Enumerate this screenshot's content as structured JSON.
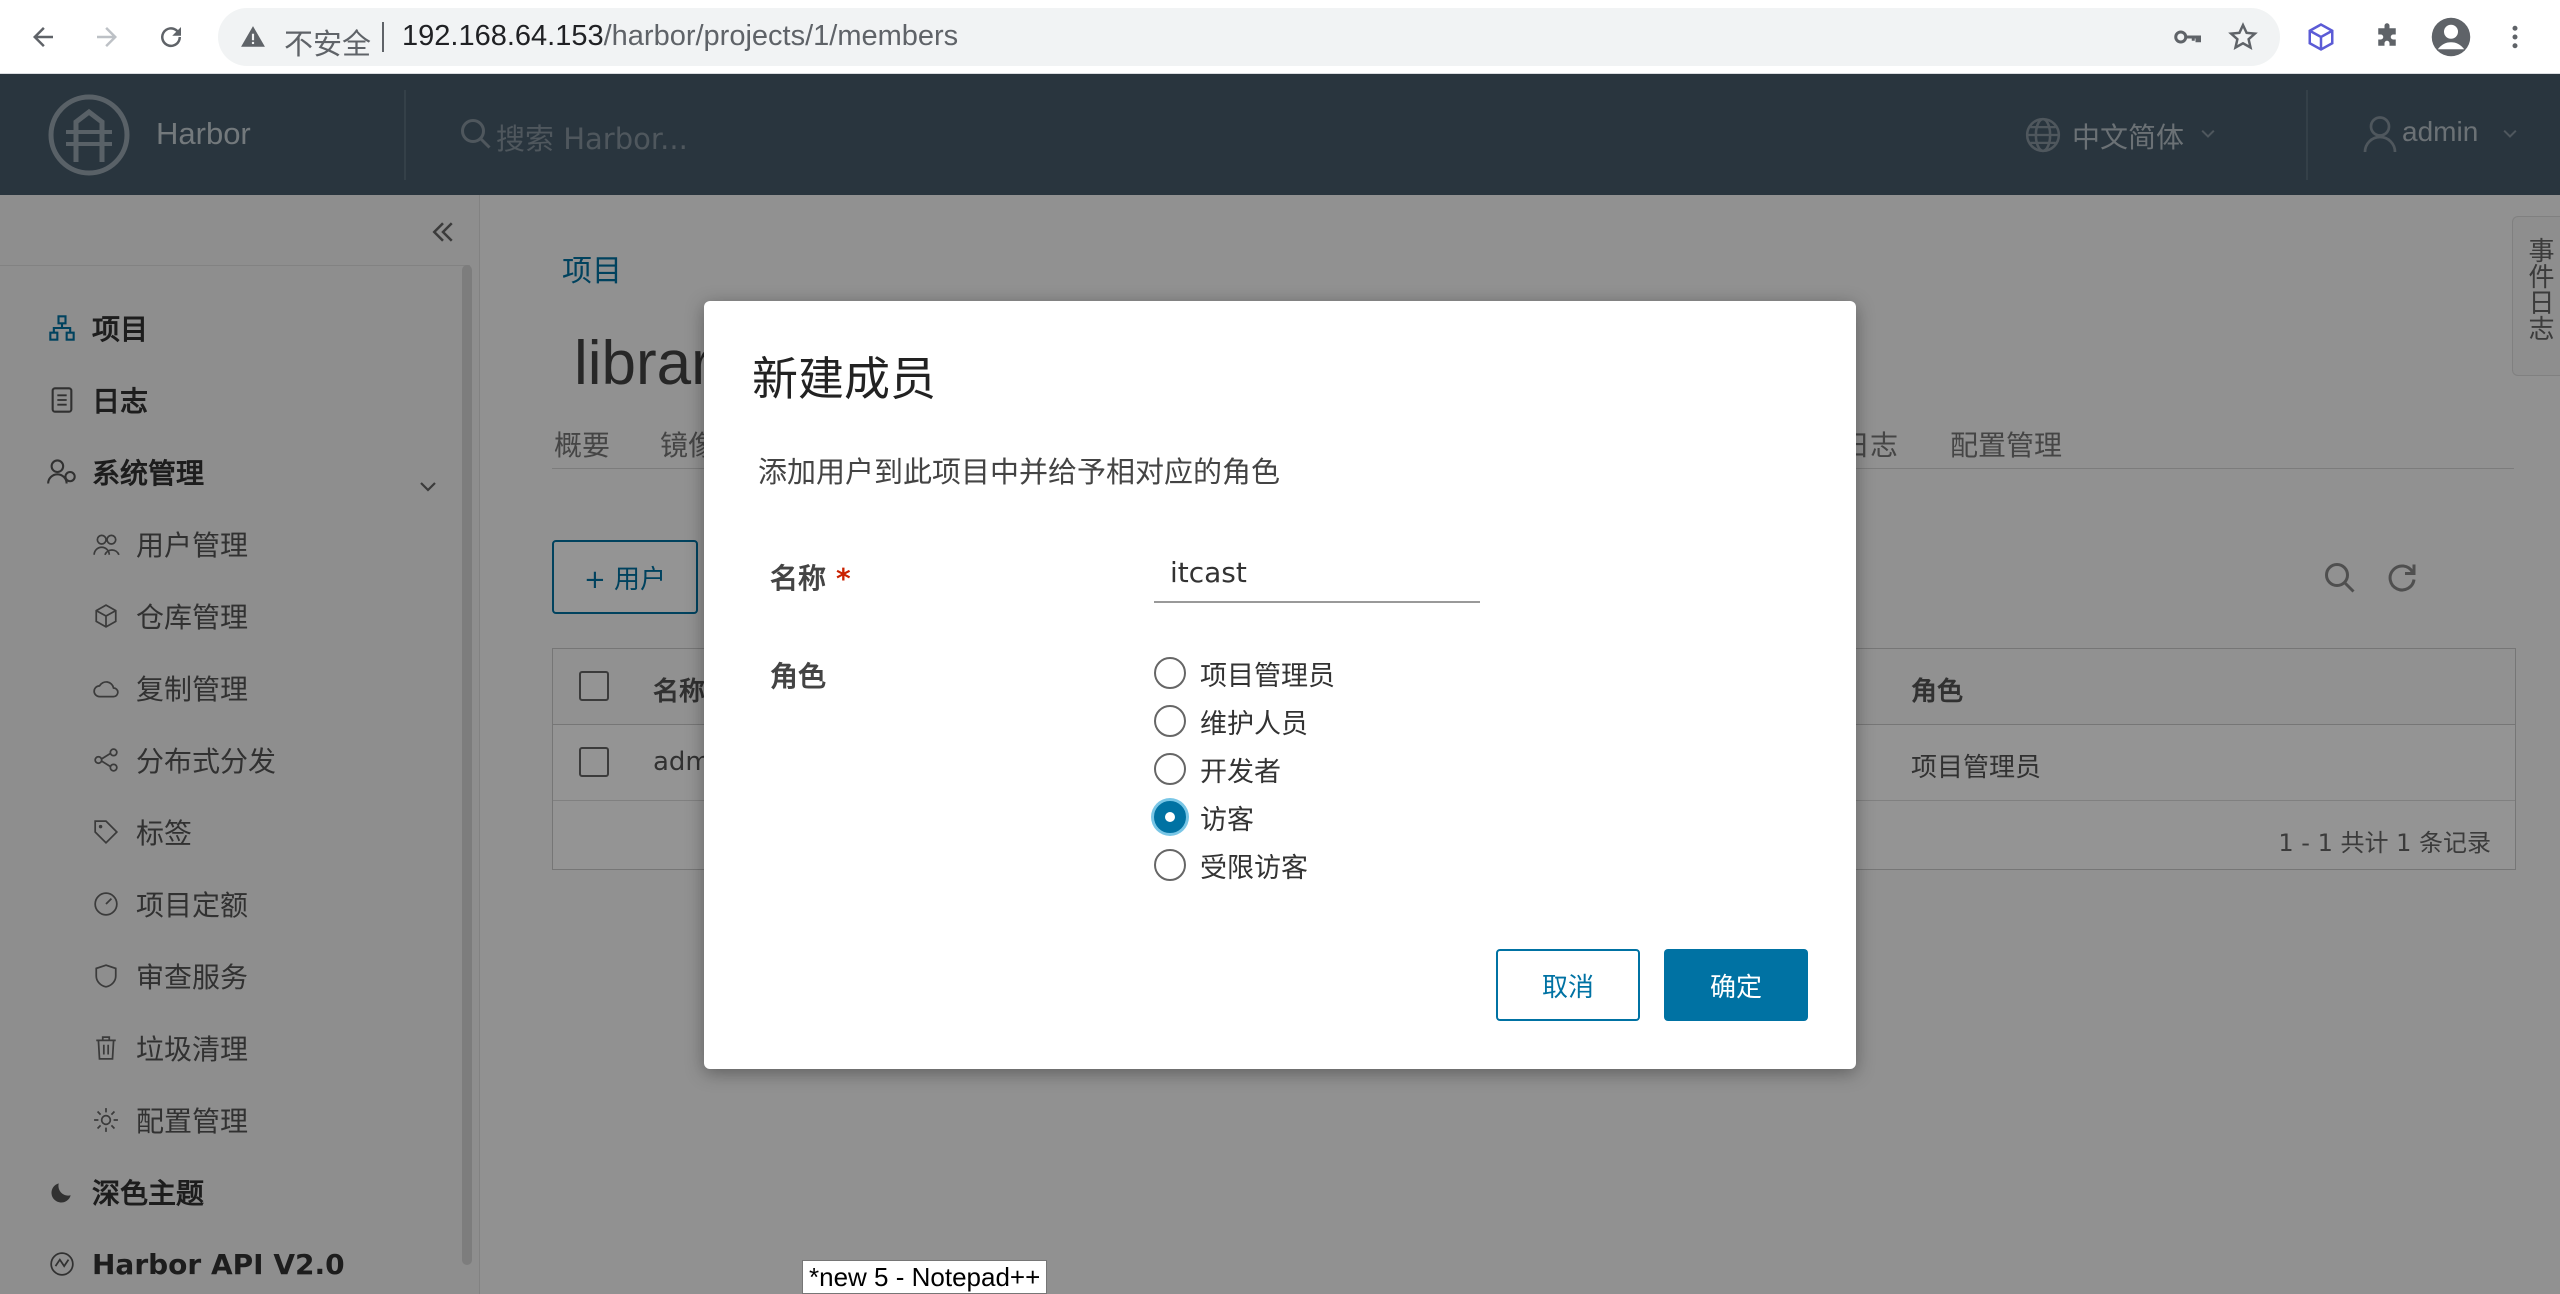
{
  "browser": {
    "insecure_label": "不安全",
    "url_host": "192.168.64.153",
    "url_path": "/harbor/projects/1/members"
  },
  "header": {
    "brand": "Harbor",
    "search_placeholder": "搜索 Harbor...",
    "language": "中文简体",
    "user": "admin"
  },
  "sidebar": {
    "items": [
      {
        "label": "项目"
      },
      {
        "label": "日志"
      },
      {
        "label": "系统管理"
      },
      {
        "label": "用户管理"
      },
      {
        "label": "仓库管理"
      },
      {
        "label": "复制管理"
      },
      {
        "label": "分布式分发"
      },
      {
        "label": "标签"
      },
      {
        "label": "项目定额"
      },
      {
        "label": "审查服务"
      },
      {
        "label": "垃圾清理"
      },
      {
        "label": "配置管理"
      },
      {
        "label": "深色主题"
      },
      {
        "label": "Harbor API V2.0"
      }
    ]
  },
  "main": {
    "breadcrumb": "项目",
    "project_title": "library",
    "tabs": [
      "概要",
      "镜像仓库",
      "日志",
      "配置管理"
    ],
    "add_user_label": "+ 用户",
    "grid": {
      "col_name": "名称",
      "col_role": "角色",
      "row_name": "admin",
      "row_role": "项目管理员",
      "footer": "1 - 1 共计 1 条记录"
    },
    "event_tab": "事件日志"
  },
  "modal": {
    "title": "新建成员",
    "description": "添加用户到此项目中并给予相对应的角色",
    "name_label": "名称",
    "required_mark": "*",
    "name_value": "itcast",
    "role_label": "角色",
    "roles": [
      "项目管理员",
      "维护人员",
      "开发者",
      "访客",
      "受限访客"
    ],
    "selected_role": "访客",
    "cancel_label": "取消",
    "ok_label": "确定"
  },
  "taskbar_tooltip": "*new 5 - Notepad++",
  "colors": {
    "header_bg": "#485c6c",
    "accent": "#0072a3",
    "required": "#c92100"
  }
}
